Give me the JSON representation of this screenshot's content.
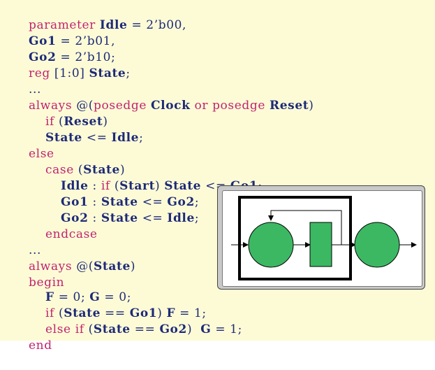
{
  "code": {
    "l1": {
      "kw": "parameter",
      "id": "Idle",
      "rest": " = 2’b00,"
    },
    "l2": {
      "id": "Go1",
      "rest": " = 2’b01,"
    },
    "l3": {
      "id": "Go2",
      "rest": " = 2’b10;"
    },
    "l4": {
      "kw": "reg",
      "rest": " [1:0] ",
      "id": "State",
      "rest2": ";"
    },
    "l5": {
      "rest": "..."
    },
    "l6": {
      "kw": "always",
      "rest": " @(",
      "kw2": "posedge",
      "id": "Clock",
      "kw3": "or",
      "kw4": "posedge",
      "id2": "Reset",
      "rest2": ")"
    },
    "l7": {
      "kw": "if",
      "rest": " (",
      "id": "Reset",
      "rest2": ")"
    },
    "l8": {
      "id": "State",
      "rest": " <= ",
      "id2": "Idle",
      "rest2": ";"
    },
    "l9": {
      "kw": "else"
    },
    "l10": {
      "kw": "case",
      "rest": " (",
      "id": "State",
      "rest2": ")"
    },
    "l11": {
      "id": "Idle",
      "rest": " : ",
      "kw": "if",
      "rest2": " (",
      "id2": "Start",
      "rest3": ") ",
      "id3": "State",
      "rest4": " <= ",
      "id4": "Go1",
      "rest5": ";"
    },
    "l12": {
      "id": "Go1",
      "rest": " : ",
      "id2": "State",
      "rest2": " <= ",
      "id3": "Go2",
      "rest3": ";"
    },
    "l13": {
      "id": "Go2",
      "rest": " : ",
      "id2": "State",
      "rest2": " <= ",
      "id3": "Idle",
      "rest3": ";"
    },
    "l14": {
      "kw": "endcase"
    },
    "l15": {
      "rest": "..."
    },
    "l16": {
      "kw": "always",
      "rest": " @(",
      "id": "State",
      "rest2": ")"
    },
    "l17": {
      "kw": "begin"
    },
    "l18": {
      "id": "F",
      "rest": " = 0; ",
      "id2": "G",
      "rest2": " = 0;"
    },
    "l19": {
      "kw": "if",
      "rest": " (",
      "id": "State",
      "rest2": " == ",
      "id2": "Go1",
      "rest3": ") ",
      "id3": "F",
      "rest4": " = 1;"
    },
    "l20": {
      "kw": "else",
      "kw2": "if",
      "rest": " (",
      "id": "State",
      "rest2": " == ",
      "id2": "Go2",
      "rest3": ")  ",
      "id3": "G",
      "rest4": " = 1;"
    },
    "l21": {
      "kw": "end"
    }
  },
  "diagram": {
    "colors": {
      "fill": "#3cb863",
      "stroke": "#000000",
      "frame": "#c9c9c9"
    },
    "shapes": [
      "state-circle",
      "register-rect",
      "state-circle"
    ]
  }
}
